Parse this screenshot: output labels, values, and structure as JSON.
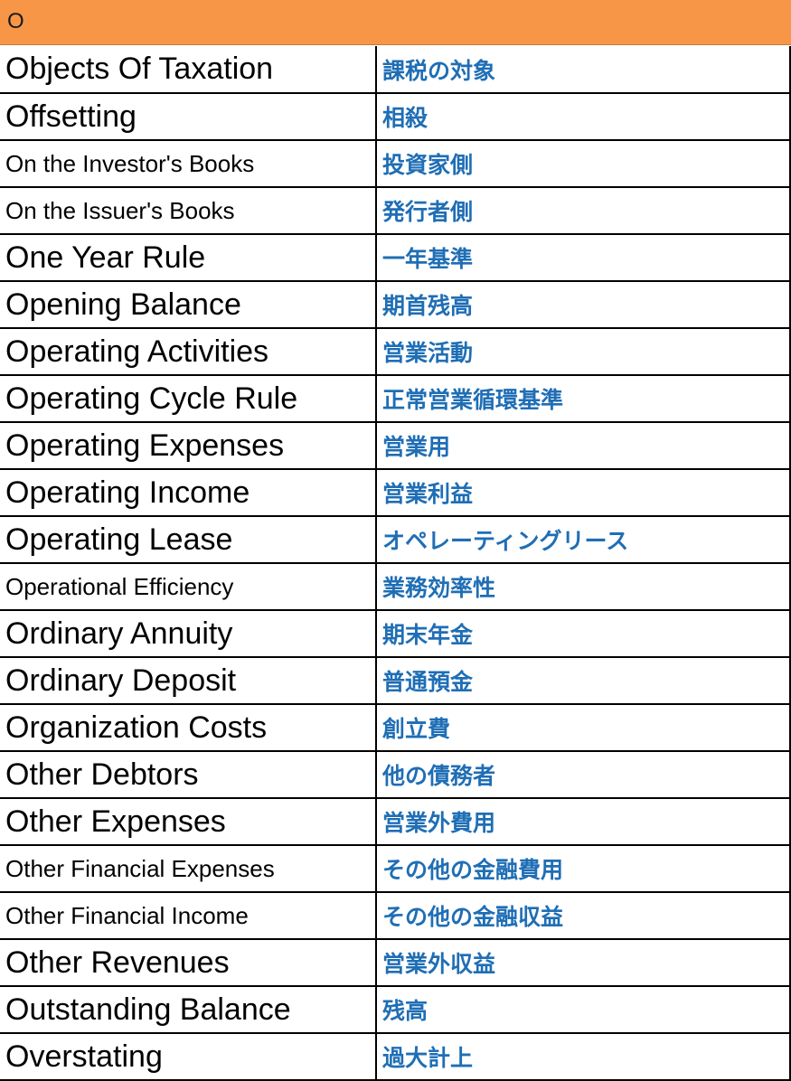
{
  "section": {
    "letter": "O",
    "header_color": "#f79646"
  },
  "colors": {
    "term_text": "#000000",
    "translation_text": "#1f6eb5"
  },
  "rows": [
    {
      "term": "Objects Of Taxation",
      "translation": "課税の対象",
      "size": "large"
    },
    {
      "term": "Offsetting",
      "translation": "相殺",
      "size": "large"
    },
    {
      "term": "On the Investor's Books",
      "translation": "投資家側",
      "size": "small"
    },
    {
      "term": "On the Issuer's Books",
      "translation": "発行者側",
      "size": "small"
    },
    {
      "term": "One Year Rule",
      "translation": "一年基準",
      "size": "large"
    },
    {
      "term": "Opening Balance",
      "translation": "期首残高",
      "size": "large"
    },
    {
      "term": "Operating Activities",
      "translation": "営業活動",
      "size": "large"
    },
    {
      "term": "Operating Cycle Rule",
      "translation": "正常営業循環基準",
      "size": "large"
    },
    {
      "term": "Operating Expenses",
      "translation": "営業用",
      "size": "large"
    },
    {
      "term": "Operating Income",
      "translation": "営業利益",
      "size": "large"
    },
    {
      "term": "Operating Lease",
      "translation": "オペレーティングリース",
      "size": "large"
    },
    {
      "term": "Operational Efficiency",
      "translation": "業務効率性",
      "size": "small"
    },
    {
      "term": "Ordinary Annuity",
      "translation": "期末年金",
      "size": "large"
    },
    {
      "term": "Ordinary Deposit",
      "translation": "普通預金",
      "size": "large"
    },
    {
      "term": "Organization Costs",
      "translation": "創立費",
      "size": "large"
    },
    {
      "term": "Other Debtors",
      "translation": "他の債務者",
      "size": "large"
    },
    {
      "term": "Other Expenses",
      "translation": "営業外費用",
      "size": "large"
    },
    {
      "term": "Other Financial Expenses",
      "translation": "その他の金融費用",
      "size": "small"
    },
    {
      "term": "Other Financial Income",
      "translation": "その他の金融収益",
      "size": "small"
    },
    {
      "term": "Other Revenues",
      "translation": "営業外収益",
      "size": "large"
    },
    {
      "term": "Outstanding Balance",
      "translation": "残高",
      "size": "large"
    },
    {
      "term": "Overstating",
      "translation": "過大計上",
      "size": "large"
    }
  ]
}
